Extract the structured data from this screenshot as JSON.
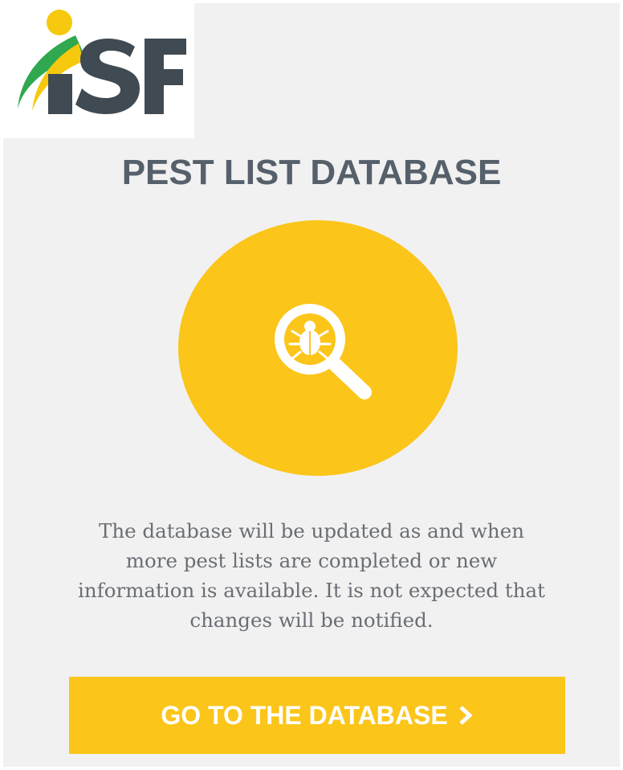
{
  "logo": {
    "brand_text": "iSF",
    "colors": {
      "dot": "#f6c90e",
      "swoosh_yellow": "#f6c90e",
      "swoosh_green": "#2fa84f",
      "letters": "#3f4a52"
    }
  },
  "card": {
    "title": "PEST LIST DATABASE",
    "icon": "magnifier-bug-icon",
    "description": "The database will be updated as and when more pest lists are completed or new information is available. It is not expected that changes will be notified.",
    "button": {
      "label": "GO TO THE DATABASE",
      "icon": "chevron-right-icon"
    }
  },
  "colors": {
    "accent": "#fbc51a",
    "title": "#56606b",
    "text": "#6a6e74",
    "card_background": "#f1f1f1"
  }
}
